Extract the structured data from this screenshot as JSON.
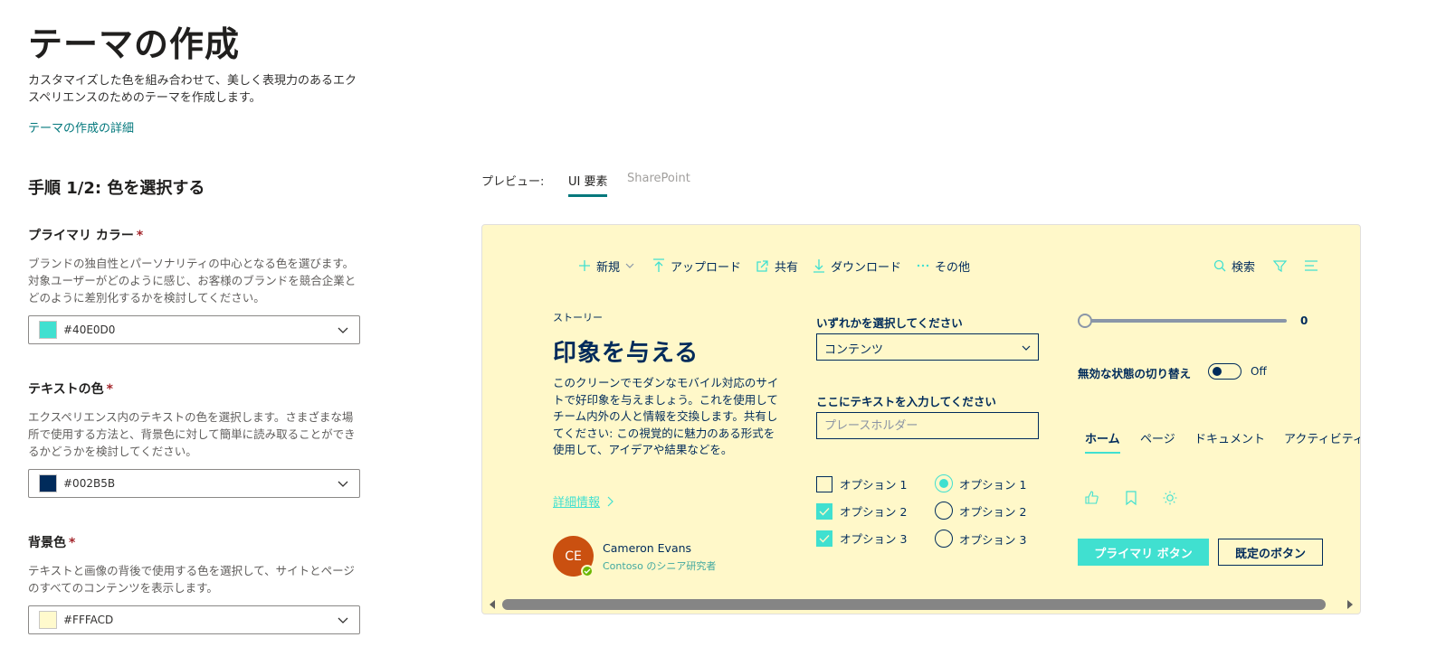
{
  "page": {
    "title": "テーマの作成",
    "description": "カスタマイズした色を組み合わせて、美しく表現力のあるエクスペリエンスのためのテーマを作成します。",
    "learn_link": "テーマの作成の詳細",
    "step_title": "手順 1/2: 色を選択する"
  },
  "fields": {
    "primary": {
      "label": "プライマリ カラー",
      "required": "*",
      "description": "ブランドの独自性とパーソナリティの中心となる色を選びます。対象ユーザーがどのように感じ、お客様のブランドを競合企業とどのように差別化するかを検討してください。",
      "value": "#40E0D0",
      "swatch": "#40E0D0"
    },
    "text": {
      "label": "テキストの色",
      "required": "*",
      "description": "エクスペリエンス内のテキストの色を選択します。さまざまな場所で使用する方法と、背景色に対して簡単に読み取ることができるかどうかを検討してください。",
      "value": "#002B5B",
      "swatch": "#002B5B"
    },
    "background": {
      "label": "背景色",
      "required": "*",
      "description": "テキストと画像の背後で使用する色を選択して、サイトとページのすべてのコンテンツを表示します。",
      "value": "#FFFACD",
      "swatch": "#FFFACD"
    }
  },
  "preview": {
    "label": "プレビュー:",
    "tabs": [
      "UI 要素",
      "SharePoint"
    ],
    "cmdbar": {
      "new": "新規",
      "upload": "アップロード",
      "share": "共有",
      "download": "ダウンロード",
      "more": "その他",
      "search": "検索"
    },
    "story": {
      "kicker": "ストーリー",
      "title": "印象を与える",
      "body": "このクリーンでモダンなモバイル対応のサイトで好印象を与えましょう。これを使用して チーム内外の人と情報を交換します。共有してください: この視覚的に魅力のある形式を使用して、アイデアや結果などを。",
      "more": "詳細情報",
      "avatar_initials": "CE",
      "person_name": "Cameron Evans",
      "person_role": "Contoso のシニア研究者"
    },
    "controls": {
      "select_label": "いずれかを選択してください",
      "select_value": "コンテンツ",
      "input_label": "ここにテキストを入力してください",
      "input_placeholder": "プレースホルダー",
      "checkboxes": [
        {
          "label": "オプション 1",
          "checked": false
        },
        {
          "label": "オプション 2",
          "checked": true
        },
        {
          "label": "オプション 3",
          "checked": true
        }
      ],
      "radios": [
        {
          "label": "オプション 1",
          "checked": true
        },
        {
          "label": "オプション 2",
          "checked": false
        },
        {
          "label": "オプション 3",
          "checked": false
        }
      ],
      "slider_value": "0",
      "toggle_label": "無効な状態の切り替え",
      "toggle_state": "Off",
      "pivots": [
        "ホーム",
        "ページ",
        "ドキュメント",
        "アクティビティ"
      ],
      "primary_button": "プライマリ ボタン",
      "default_button": "既定のボタン"
    },
    "colors": {
      "primary": "#40E0D0",
      "text": "#002B5B",
      "background": "#FFF8C9"
    }
  }
}
